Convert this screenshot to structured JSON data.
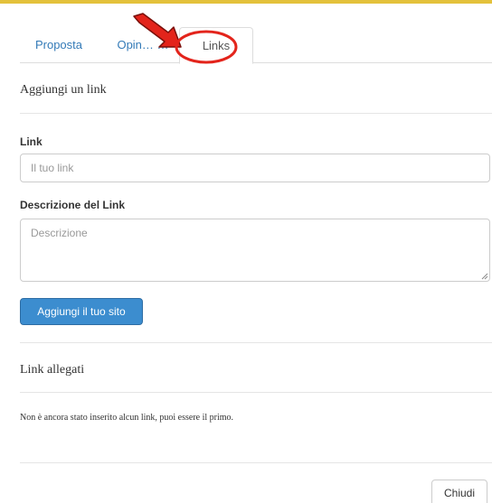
{
  "tabs": {
    "proposta": "Proposta",
    "opinioni": "Opin… …",
    "links": "Links"
  },
  "add_link": {
    "title": "Aggiungi un link",
    "link_label": "Link",
    "link_placeholder": "Il tuo link",
    "description_label": "Descrizione del Link",
    "description_placeholder": "Descrizione",
    "submit_label": "Aggiungi il tuo sito"
  },
  "attached_links": {
    "title": "Link allegati",
    "empty_message": "Non è ancora stato inserito alcun link, puoi essere il primo."
  },
  "footer": {
    "close_label": "Chiudi"
  },
  "colors": {
    "top_bar": "#e3c13b",
    "tab_link": "#337ab7",
    "primary_button": "#3c8dcf",
    "annotation_red": "#e3241b"
  },
  "annotations": {
    "arrow": "red-arrow-icon",
    "ring": "red-highlight-ellipse"
  }
}
